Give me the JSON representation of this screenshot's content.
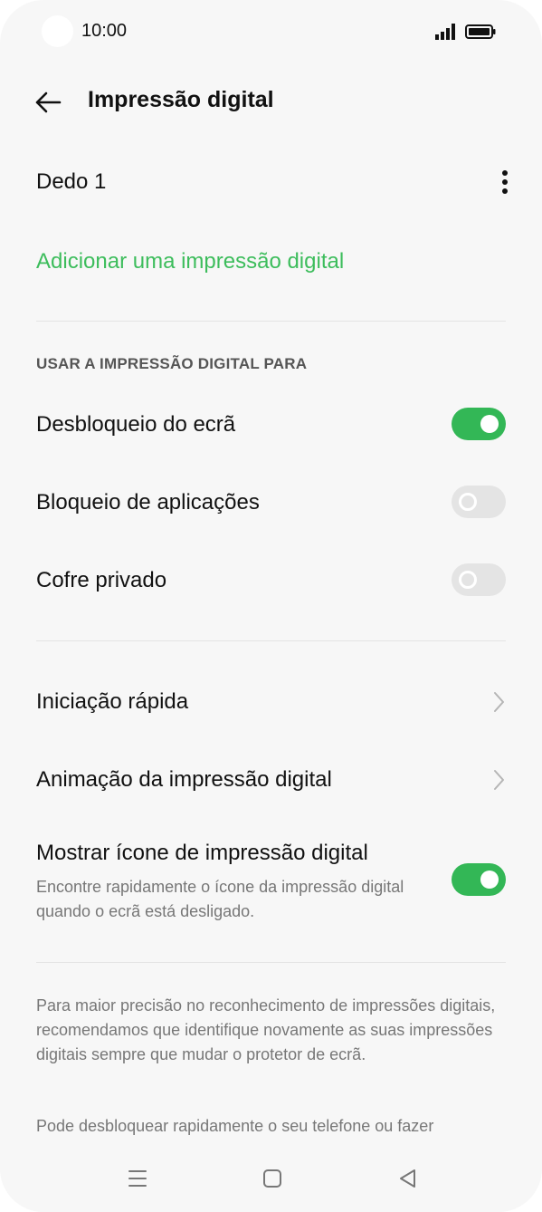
{
  "status_bar": {
    "time": "10:00"
  },
  "header": {
    "title": "Impressão digital",
    "back_icon": "arrow-left-icon"
  },
  "finger": {
    "label": "Dedo 1",
    "menu_icon": "more-vertical-icon"
  },
  "add_link": "Adicionar uma impressão digital",
  "section_header": "USAR A IMPRESSÃO DIGITAL PARA",
  "toggles": [
    {
      "label": "Desbloqueio do ecrã",
      "on": true
    },
    {
      "label": "Bloqueio de aplicações",
      "on": false
    },
    {
      "label": "Cofre privado",
      "on": false
    }
  ],
  "links": [
    {
      "label": "Iniciação rápida"
    },
    {
      "label": "Animação da impressão digital"
    }
  ],
  "show_icon": {
    "label": "Mostrar ícone de impressão digital",
    "description": "Encontre rapidamente o ícone da impressão digital quando o ecrã está desligado.",
    "on": true
  },
  "info": {
    "paragraph1": "Para maior precisão no reconhecimento de impressões digitais, recomendamos que identifique novamente as suas impressões digitais sempre que mudar o protetor de ecrã.",
    "paragraph2": "Pode desbloquear rapidamente o seu telefone ou fazer"
  },
  "nav_bar": {
    "icons": [
      "menu-icon",
      "home-square-icon",
      "back-triangle-icon"
    ]
  },
  "colors": {
    "accent": "#33b756",
    "link": "#3dbd5c",
    "background": "#f7f7f7"
  }
}
